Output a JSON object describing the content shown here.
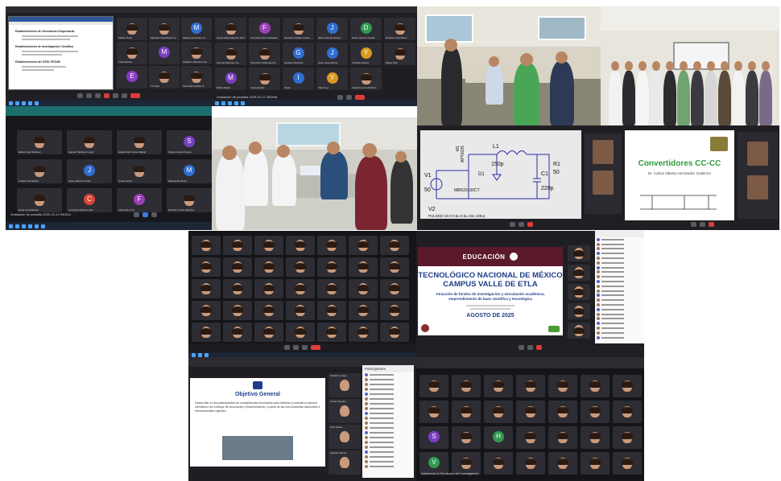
{
  "panels": {
    "p1": {
      "doc_heading_1": "Establecimiento de Vinculación Empresarial",
      "doc_heading_2": "Establecimiento de Investigación Científica",
      "doc_heading_3": "Establecimiento del CEIS-TECNM",
      "participants": [
        {
          "name": "Mathis Sivari",
          "initial": "",
          "color": "#7c5a45"
        },
        {
          "name": "Maricela Castañeda Ce..",
          "initial": "",
          "color": "#7c5a45"
        },
        {
          "name": "Melisa Hernández Cr..",
          "initial": "M",
          "color": "#2f6fd1"
        },
        {
          "name": "Tritia Ramos",
          "initial": "",
          "color": "#7c5a45"
        },
        {
          "name": "",
          "initial": "M",
          "color": "#7b3fc2"
        },
        {
          "name": "Guillermo Martínez Sa..",
          "initial": "",
          "color": "#7c5a45"
        },
        {
          "name": "",
          "initial": "E",
          "color": "#8d3cc4"
        },
        {
          "name": "TV Gabi",
          "initial": "",
          "color": "#7c5a45"
        },
        {
          "name": "Fernando Andrés S..",
          "initial": "",
          "color": "#7c5a45"
        }
      ],
      "status": "Grabación de pantalla 2025-10-17 090416",
      "buttons": [
        "Chat",
        "Personas",
        "Levantar",
        "Reaccionar",
        "Cámara",
        "Micrófono",
        "Compartir",
        "Salir"
      ]
    },
    "p2": {
      "participants": [
        {
          "name": "Reyes Alicia Maurino Ruiz..",
          "initial": "",
          "color": "#7c5a45"
        },
        {
          "name": "Fernando Díaz Sebastian",
          "initial": "F",
          "color": "#9b3fb8"
        },
        {
          "name": "Gonzalo Castillo Huerta",
          "initial": "",
          "color": "#7c5a45"
        },
        {
          "name": "Jaime Alfredo Rangel",
          "initial": "J",
          "color": "#2f6fd1"
        },
        {
          "name": "Dulce Garrido Ocaña",
          "initial": "D",
          "color": "#2e9b4f"
        },
        {
          "name": "Rosario Luna Pérez",
          "initial": "",
          "color": "#7c5a45"
        },
        {
          "name": "Ximena Martínez Ca..",
          "initial": "",
          "color": "#7c5a45"
        },
        {
          "name": "Fernando Cárdenas Ro..",
          "initial": "",
          "color": "#7c5a45"
        },
        {
          "name": "Gustavo Ramírez",
          "initial": "G",
          "color": "#2f6fd1"
        },
        {
          "name": "Justo José García",
          "initial": "J",
          "color": "#2f6fd1"
        },
        {
          "name": "Yolanda Jaimes",
          "initial": "Y",
          "color": "#d99a1e"
        },
        {
          "name": "Edgar Ruiz",
          "initial": "",
          "color": "#7c5a45"
        },
        {
          "name": "Mario Zárate",
          "initial": "M",
          "color": "#7b3fc2"
        },
        {
          "name": "Laura Aguilar",
          "initial": "",
          "color": "#7c5a45"
        },
        {
          "name": "Israel",
          "initial": "I",
          "color": "#2f6fd1"
        },
        {
          "name": "Yanet Ley",
          "initial": "Y",
          "color": "#d99a1e"
        },
        {
          "name": "Usuarios sin micrófono",
          "initial": "",
          "color": "#7c5a45"
        }
      ],
      "status": "Grabación de pantalla 2025-10-17 090948"
    },
    "p4": {
      "participants": [
        {
          "name": "Esther Jara Martínez",
          "initial": "",
          "color": "#7c5a45"
        },
        {
          "name": "Agustín Martínez López",
          "initial": "",
          "color": "#7c5a45"
        },
        {
          "name": "Isabel Ruiz Cortés Miguel",
          "initial": "",
          "color": "#7c5a45"
        },
        {
          "name": "Sergio Gómez Reyes",
          "initial": "S",
          "color": "#7b3fc2"
        },
        {
          "name": "Lizbeth Hernández",
          "initial": "",
          "color": "#7c5a45"
        },
        {
          "name": "Javier Alberto Ochoa",
          "initial": "J",
          "color": "#2f6fd1"
        },
        {
          "name": "Cesar Flores",
          "initial": "",
          "color": "#7c5a45"
        },
        {
          "name": "Manuel Mendoza",
          "initial": "M",
          "color": "#2f6fd1"
        },
        {
          "name": "Rosa Lina Méndez",
          "initial": "",
          "color": "#7c5a45"
        },
        {
          "name": "Consuelo Méndez Hdz.",
          "initial": "C",
          "color": "#d9473a"
        },
        {
          "name": "Fernanda Cruz",
          "initial": "F",
          "color": "#9b3fb8"
        },
        {
          "name": "Ricardo Cortés Sánchez",
          "initial": "",
          "color": "#7c5a45"
        }
      ],
      "status": "Grabación de pantalla 2025-10-14 090514"
    },
    "p7": {
      "l1": "L1",
      "l1v": "150p",
      "c1": "C1",
      "c1v": "220p",
      "r1": "R1",
      "r1v": "50",
      "v1": "V1",
      "v1v": "50",
      "v2": "V2",
      "d1": "D1",
      "d1v": "MBR20100CT",
      "m1": "M1",
      "m1v": "APT6035",
      "cmd": "PULSE(0 10 0 0.5u 0.5u 10u 100u)"
    },
    "p8": {
      "title": "Convertidores CC-CC",
      "author": "Dr. Carlos Alberto Hernández Gutiérrez"
    },
    "p10": {
      "ministry": "EDUCACIÓN",
      "title1": "TECNOLÓGICO NACIONAL DE MÉXICO",
      "title2": "CAMPUS VALLE DE ETLA",
      "subtitle": "Atracción de fondos de investigación y vinculación académica, emprendimiento de base científica y tecnológica",
      "date": "AGOSTO DE 2025"
    },
    "p11": {
      "slide_title": "Objetivo General",
      "slide_body": "Desarrollar en los participantes las competencias necesarias para detectar y postular proyectos científicos con enfoque de vinculación y financiamiento, a partir de las convocatorias nacionales e internacionales vigentes.",
      "participants_title": "Participantes",
      "side_names": [
        "Guillermo Laye..",
        "Carlos Sandov..",
        "Felix Hilario",
        "Agustín Espino.."
      ]
    },
    "p12": {
      "status": "Asistencia al Seminario de Investigación"
    }
  },
  "colors": {
    "zoom_dark": "#1f1f23",
    "teams_purple": "#5b5fc7",
    "leave_red": "#e23b3b",
    "tecnm_blue": "#1f3d8a",
    "green_title": "#2f9a3a"
  }
}
